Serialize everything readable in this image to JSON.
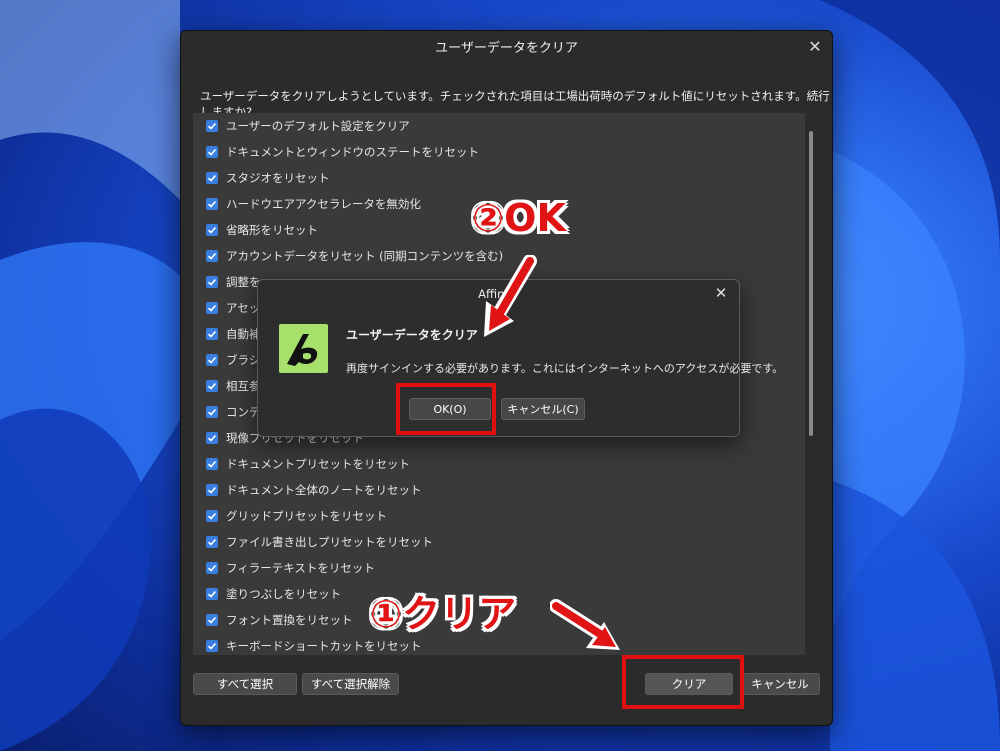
{
  "main_dialog": {
    "title": "ユーザーデータをクリア",
    "prompt": "ユーザーデータをクリアしようとしています。チェックされた項目は工場出荷時のデフォルト値にリセットされます。続行しますか?",
    "items": [
      "ユーザーのデフォルト設定をクリア",
      "ドキュメントとウィンドウのステートをリセット",
      "スタジオをリセット",
      "ハードウエアアクセラレータを無効化",
      "省略形をリセット",
      "アカウントデータをリセット (同期コンテンツを含む)",
      "調整を",
      "アセット",
      "自動補",
      "ブラシを",
      "相互参",
      "コンテン",
      "現像プリセットをリセット",
      "ドキュメントプリセットをリセット",
      "ドキュメント全体のノートをリセット",
      "グリッドプリセットをリセット",
      "ファイル書き出しプリセットをリセット",
      "フィラーテキストをリセット",
      "塗りつぶしをリセット",
      "フォント置換をリセット",
      "キーボードショートカットをリセット"
    ],
    "select_all_label": "すべて選択",
    "deselect_all_label": "すべて選択解除",
    "clear_label": "クリア",
    "cancel_label": "キャンセル"
  },
  "modal": {
    "title": "Affinity",
    "heading": "ユーザーデータをクリア",
    "message": "再度サインインする必要があります。これにはインターネットへのアクセスが必要です。",
    "ok_label": "OK(O)",
    "cancel_label": "キャンセル(C)"
  },
  "annotations": {
    "step1": "①クリア",
    "step2": "②OK"
  },
  "colors": {
    "highlight": "#e01010",
    "checkbox": "#3a7ee0",
    "app_icon": "#a8e06c"
  }
}
